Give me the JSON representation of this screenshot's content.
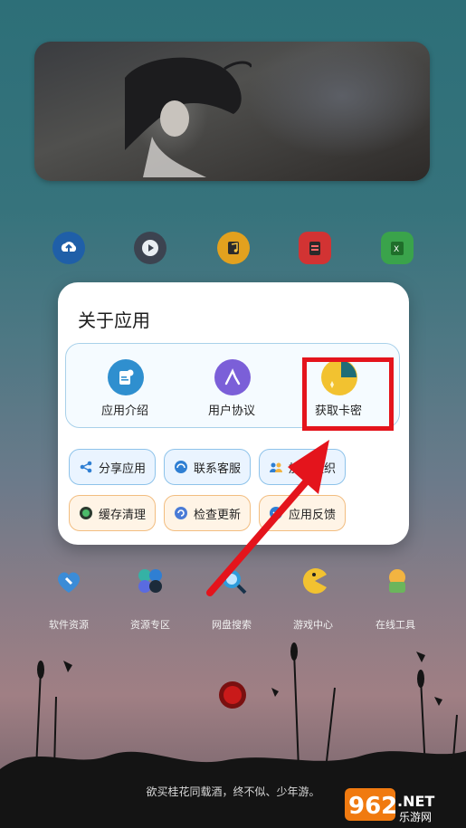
{
  "top_row_apps": [
    {
      "name": "upload-cloud",
      "icon": "cloud-upload-icon"
    },
    {
      "name": "video",
      "icon": "play-icon"
    },
    {
      "name": "music",
      "icon": "music-icon"
    },
    {
      "name": "notes",
      "icon": "clipboard-icon"
    },
    {
      "name": "excel",
      "icon": "spreadsheet-icon"
    }
  ],
  "bottom_row_apps": [
    {
      "label": "软件资源",
      "icon": "software-icon"
    },
    {
      "label": "资源专区",
      "icon": "flower-icon"
    },
    {
      "label": "网盘搜索",
      "icon": "search-icon"
    },
    {
      "label": "游戏中心",
      "icon": "pacman-icon"
    },
    {
      "label": "在线工具",
      "icon": "toolbox-icon"
    }
  ],
  "dialog": {
    "title": "关于应用",
    "top_items": [
      {
        "label": "应用介绍",
        "icon": "info-doc-icon",
        "color": "#2f8fcf"
      },
      {
        "label": "用户协议",
        "icon": "agreement-icon",
        "color": "#7b5fd8"
      },
      {
        "label": "获取卡密",
        "icon": "card-key-icon",
        "color": "#f2c230"
      }
    ],
    "chips_row1": [
      {
        "label": "分享应用",
        "icon": "share-icon"
      },
      {
        "label": "联系客服",
        "icon": "headset-icon"
      },
      {
        "label": "加入组织",
        "icon": "group-icon"
      }
    ],
    "chips_row2": [
      {
        "label": "缓存清理",
        "icon": "clean-icon"
      },
      {
        "label": "检查更新",
        "icon": "update-icon"
      },
      {
        "label": "应用反馈",
        "icon": "feedback-icon"
      }
    ]
  },
  "footer_quote": "欲买桂花同载酒，终不似、少年游。",
  "watermark": {
    "brand": "962",
    "suffix": ".NET",
    "sub": "乐游网"
  },
  "colors": {
    "highlight": "#e4141c",
    "arrow": "#e4141c"
  }
}
